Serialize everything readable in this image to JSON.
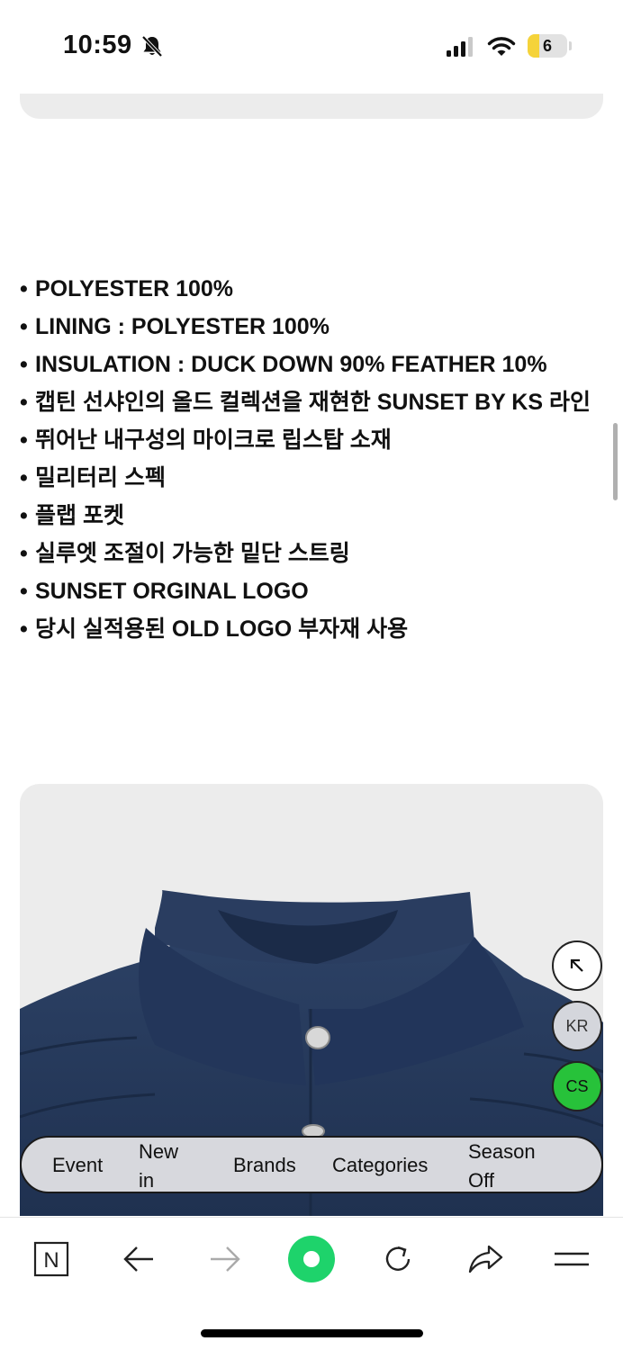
{
  "status_bar": {
    "time": "10:59",
    "battery_level": "6",
    "icons": [
      "bell-muted-icon",
      "cellular-signal-icon",
      "wifi-icon",
      "battery-icon"
    ]
  },
  "spec_list": {
    "bullet": "•",
    "items": [
      "POLYESTER 100%",
      "LINING : POLYESTER 100%",
      "INSULATION : DUCK DOWN 90% FEATHER 10%",
      "캡틴 선샤인의 올드 컬렉션을 재현한 SUNSET BY KS 라인",
      "뛰어난 내구성의 마이크로 립스탑 소재",
      "밀리터리 스펙",
      "플랩 포켓",
      "실루엣 조절이 가능한 밑단 스트링",
      "SUNSET ORGINAL LOGO",
      "당시 실적용된 OLD LOGO 부자재 사용"
    ]
  },
  "floating_buttons": {
    "scroll_top_icon": "arrow-up-left-icon",
    "language": "KR",
    "customer_service": "CS"
  },
  "category_nav": {
    "event": "Event",
    "new_in_line1": "New",
    "new_in_line2": "in",
    "brands": "Brands",
    "categories": "Categories",
    "season_off_line1": "Season",
    "season_off_line2": "Off"
  },
  "browser_toolbar": {
    "icons": [
      "naver-n-icon",
      "back-arrow-icon",
      "forward-arrow-icon",
      "green-dot-icon",
      "reload-icon",
      "share-icon",
      "menu-icon"
    ],
    "logo_letter": "N",
    "accent_color": "#1ed36b"
  },
  "colors": {
    "card_gray": "#ececec",
    "jacket_navy": "#26395a",
    "cs_green": "#27c23a",
    "nav_gray": "#d7d8dd"
  }
}
